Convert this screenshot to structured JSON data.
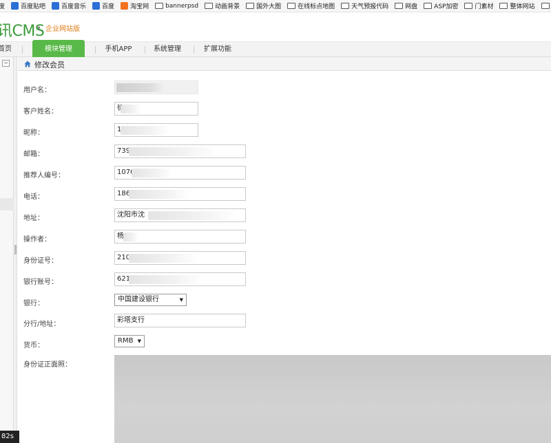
{
  "bookmarks": [
    {
      "label": "度",
      "icon": "none"
    },
    {
      "label": "百度贴吧",
      "icon": "paw-icon"
    },
    {
      "label": "百度音乐",
      "icon": "paw-icon"
    },
    {
      "label": "百度",
      "icon": "paw-icon"
    },
    {
      "label": "淘宝网",
      "icon": "taobao-icon"
    },
    {
      "label": "bannerpsd",
      "icon": "folder-icon"
    },
    {
      "label": "动画背景",
      "icon": "folder-icon"
    },
    {
      "label": "国外大图",
      "icon": "folder-icon"
    },
    {
      "label": "在线标点地图",
      "icon": "folder-icon"
    },
    {
      "label": "天气预报代码",
      "icon": "folder-icon"
    },
    {
      "label": "网盘",
      "icon": "folder-icon"
    },
    {
      "label": "ASP加密",
      "icon": "folder-icon"
    },
    {
      "label": "门素材",
      "icon": "folder-icon"
    },
    {
      "label": "整体网站",
      "icon": "folder-icon"
    },
    {
      "label": "酒店",
      "icon": "folder-icon"
    }
  ],
  "header": {
    "logo": "CMS",
    "logo_prefix": "讯",
    "edition": "企业网站版"
  },
  "nav": {
    "home": "首页",
    "active": "模块管理",
    "app": "手机APP",
    "sys": "系统管理",
    "ext": "扩展功能"
  },
  "rail": {
    "collapse": "−"
  },
  "timer": "82s",
  "page": {
    "title": "修改会员"
  },
  "form": {
    "username": {
      "label": "用户名：",
      "value": ""
    },
    "realname": {
      "label": "客户姓名：",
      "value": "徐"
    },
    "nickname": {
      "label": "昵称：",
      "value": "1"
    },
    "email": {
      "label": "邮箱：",
      "value": "739"
    },
    "referrer": {
      "label": "推荐人编号：",
      "value": "1070"
    },
    "phone": {
      "label": "电话：",
      "value": "186"
    },
    "address": {
      "label": "地址：",
      "value": "沈阳市沈"
    },
    "operator": {
      "label": "操作者：",
      "value": "杨"
    },
    "idcard": {
      "label": "身份证号：",
      "value": "210"
    },
    "bankacct": {
      "label": "银行账号：",
      "value": "621"
    },
    "bank": {
      "label": "银行：",
      "value": "中国建设银行"
    },
    "branch": {
      "label": "分行/地址：",
      "value": "彩塔支行"
    },
    "currency": {
      "label": "货币：",
      "value": "RMB"
    },
    "idphoto": {
      "label": "身份证正面照："
    }
  }
}
